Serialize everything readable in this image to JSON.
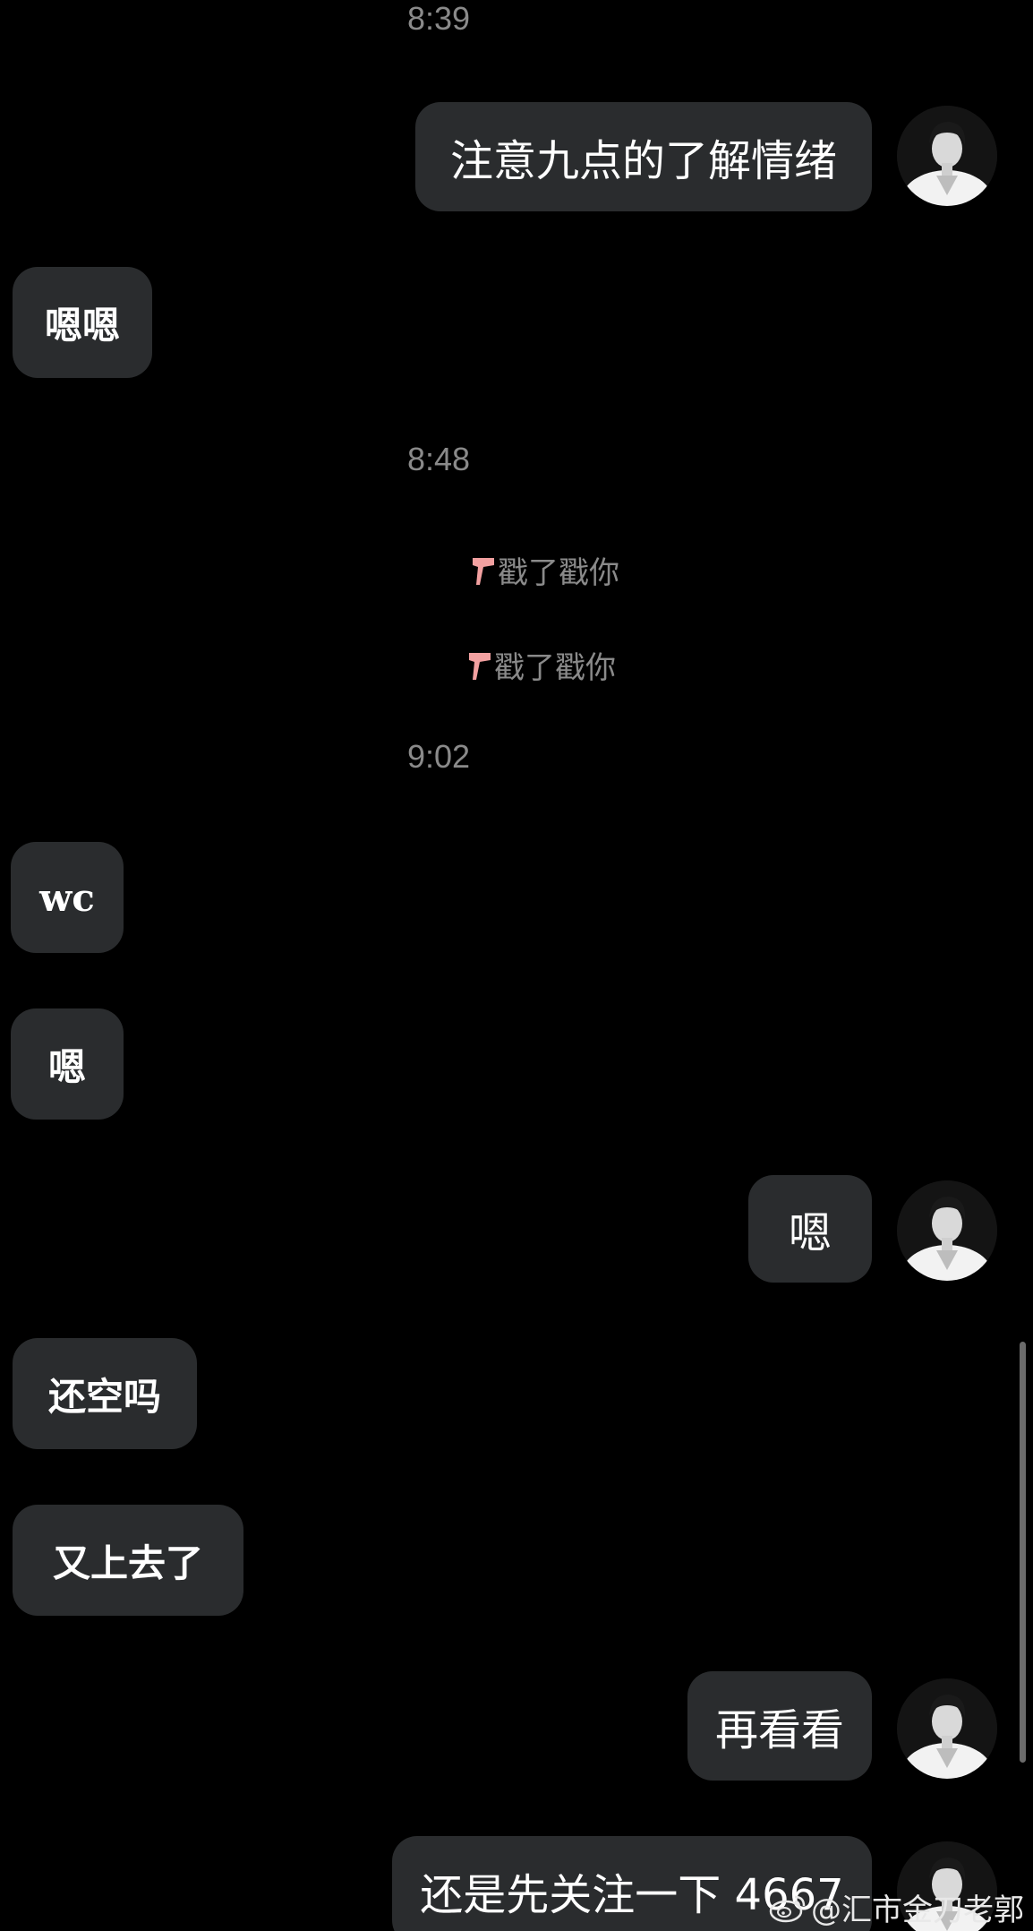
{
  "timestamps": [
    "8:39",
    "8:48",
    "9:02"
  ],
  "messages": [
    {
      "side": "right",
      "text": "注意九点的了解情绪"
    },
    {
      "side": "left",
      "text": "嗯嗯"
    },
    {
      "side": "left",
      "text": "wc"
    },
    {
      "side": "left",
      "text": "嗯"
    },
    {
      "side": "right",
      "text": "嗯"
    },
    {
      "side": "left",
      "text": "还空吗"
    },
    {
      "side": "left",
      "text": "又上去了"
    },
    {
      "side": "right",
      "text": "再看看"
    },
    {
      "side": "right",
      "text": "还是先关注一下 4667"
    }
  ],
  "poke_events": [
    "戳了戳你",
    "戳了戳你"
  ],
  "watermark": {
    "text": "@汇市金刀老郭",
    "icon": "weibo-logo-icon"
  },
  "colors": {
    "background": "#000000",
    "bubble": "#2a2c2e",
    "timestamp": "#8a8a8a",
    "poke_icon": "#f2a0a0"
  }
}
